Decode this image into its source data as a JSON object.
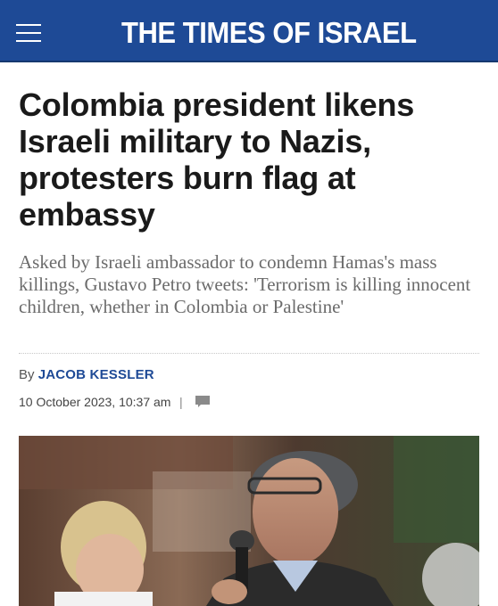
{
  "header": {
    "logo": "THE TIMES OF ISRAEL",
    "background_color": "#1e4a96",
    "menu_icon": "hamburger-menu-icon"
  },
  "article": {
    "headline": "Colombia president likens Israeli military to Nazis, protesters burn flag at embassy",
    "subhead": "Asked by Israeli ambassador to condemn Hamas's mass killings, Gustavo Petro tweets: 'Terrorism is killing innocent children, whether in Colombia or Palestine'",
    "byline_prefix": "By",
    "author": "JACOB KESSLER",
    "date": "10 October 2023, 10:37 am",
    "separator": "|",
    "comment_icon": "comment-icon",
    "accent_color": "#1e4a96"
  }
}
